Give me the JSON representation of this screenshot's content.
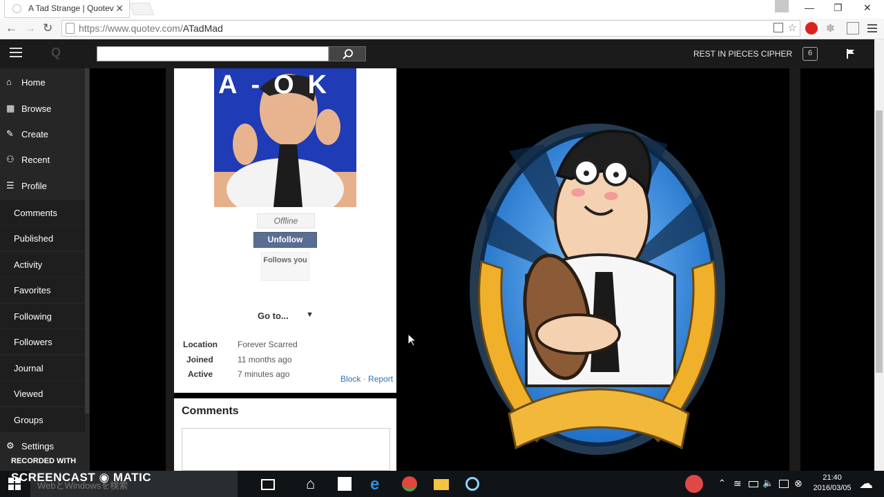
{
  "browser": {
    "tab_title": "A Tad Strange | Quotev",
    "tab_close": "✕",
    "url_prefix": "https://www.quotev.com/",
    "url_path": "ATadMad",
    "window_controls": [
      "—",
      "❐",
      "✕"
    ]
  },
  "header": {
    "logo_text": "Q",
    "username": "REST IN PIECES CIPHER",
    "notification_count": "6"
  },
  "sidebar": {
    "main_items": [
      {
        "label": "Home",
        "icon": "home-icon"
      },
      {
        "label": "Browse",
        "icon": "grid-icon"
      },
      {
        "label": "Create",
        "icon": "pencil-icon"
      },
      {
        "label": "Recent",
        "icon": "users-icon"
      },
      {
        "label": "Profile",
        "icon": "profile-icon"
      }
    ],
    "sub_items": [
      "Comments",
      "Published",
      "Activity",
      "Favorites",
      "Following",
      "Followers",
      "Journal",
      "Viewed",
      "Groups"
    ],
    "settings_label": "Settings"
  },
  "profile": {
    "avatar_text": "A-OK",
    "status": "Offline",
    "unfollow_label": "Unfollow",
    "follows_you": "Follows you",
    "goto_label": "Go to...",
    "goto_arrow": "▼",
    "location_label": "Location",
    "location_value": "Forever Scarred",
    "joined_label": "Joined",
    "joined_value": "11 months ago",
    "active_label": "Active",
    "active_value": "7 minutes ago",
    "block_label": "Block",
    "separator": "·",
    "report_label": "Report"
  },
  "comments": {
    "title": "Comments"
  },
  "overlay": {
    "recorded_with": "RECORDED WITH",
    "brand": "SCREENCAST ◉ MATIC"
  },
  "taskbar": {
    "search_placeholder": "WebとWindowsを検索",
    "time": "21:40",
    "date": "2016/03/05"
  },
  "colors": {
    "sidebar_bg": "#262626",
    "unfollow_bg": "#5a6e93",
    "link": "#2f6fc1",
    "banner_blue": "#2a7fd4"
  }
}
